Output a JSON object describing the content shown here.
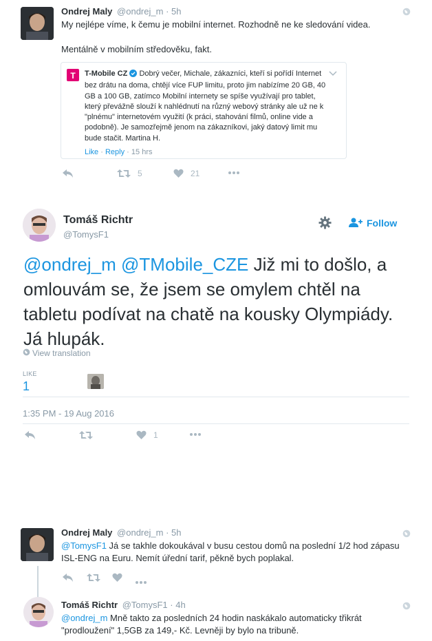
{
  "tweet1": {
    "name": "Ondrej Maly",
    "handle": "@ondrej_m",
    "time": "· 5h",
    "text_line1": "My nejlépe víme, k čemu je mobilní internet. Rozhodně ne ke sledování videa.",
    "text_line2": "Mentálně v mobilním středověku, fakt.",
    "quote": {
      "name": "T-Mobile CZ",
      "text": "Dobrý večer, Michale, zákazníci, kteří si pořídí Internet bez drátu na doma, chtějí více FUP limitu, proto jim nabízíme 20 GB, 40 GB a 100 GB, zatímco Mobilní internety se spíše využívají pro tablet, který převážně slouží k nahlédnutí na různý webový stránky ale už ne k \"plnému\" internetovém využití (k práci, stahování filmů, online vide a podobně). Je samozřejmě jenom na zákazníkovi, jaký datový limit mu bude stačit. Martina H.",
      "like": "Like",
      "reply": "Reply",
      "time": "15 hrs"
    },
    "retweets": "5",
    "likes": "21"
  },
  "main": {
    "name": "Tomáš Richtr",
    "handle": "@TomysF1",
    "follow": "Follow",
    "mention1": "@ondrej_m",
    "mention2": "@TMobile_CZE",
    "text": " Již mi to došlo, a omlouvám se, že jsem se omylem chtěl na tabletu podívat na chatě na kousky Olympiády. Já hlupák.",
    "view_translation": "View translation",
    "like_label": "LIKE",
    "like_count": "1",
    "timestamp": "1:35 PM - 19 Aug 2016",
    "action_likes": "1"
  },
  "reply1": {
    "name": "Ondrej Maly",
    "handle": "@ondrej_m",
    "time": "· 5h",
    "mention": "@TomysF1",
    "text": " Já se takhle dokoukával v busu cestou domů na poslední 1/2 hod zápasu ISL-ENG na Euru. Nemít úřední tarif, pěkně bych poplakal."
  },
  "reply2": {
    "name": "Tomáš Richtr",
    "handle": "@TomysF1",
    "time": "· 4h",
    "mention": "@ondrej_m",
    "text": " Mně takto za posledních 24 hodin naskákalo automaticky třikrát \"prodloužení\" 1,5GB za 149,- Kč. Levněji by bylo na tribuně."
  },
  "colors": {
    "link": "#1b95e0",
    "muted": "#8899a6",
    "tmobile": "#e20074"
  },
  "icons": [
    "globe-icon",
    "reply-icon",
    "retweet-icon",
    "heart-icon",
    "more-icon",
    "gear-icon",
    "follow-person-icon",
    "verified-icon",
    "chevron-down-icon"
  ]
}
